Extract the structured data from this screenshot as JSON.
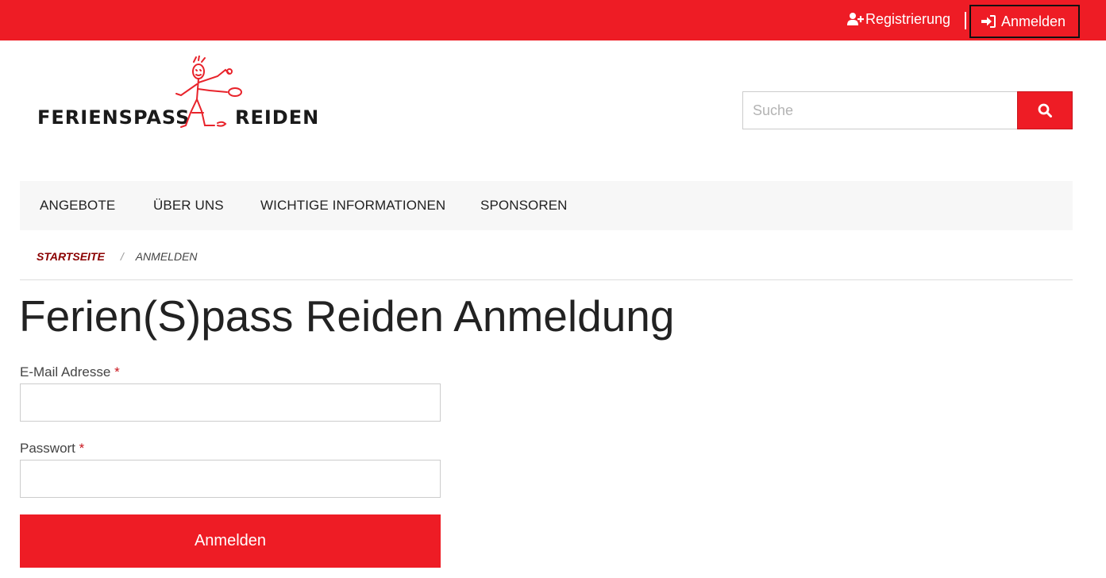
{
  "topbar": {
    "register_label": "Registrierung",
    "register_icon": "user-plus-icon",
    "login_label": "Anmelden",
    "login_icon": "sign-in-icon"
  },
  "logo": {
    "text_left": "FERIENSPASS",
    "text_right": "REIDEN"
  },
  "search": {
    "placeholder": "Suche",
    "button_icon": "search-icon"
  },
  "nav": {
    "items": [
      {
        "label": "ANGEBOTE"
      },
      {
        "label": "ÜBER UNS"
      },
      {
        "label": "WICHTIGE INFORMATIONEN"
      },
      {
        "label": "SPONSOREN"
      }
    ]
  },
  "breadcrumb": {
    "home": "STARTSEITE",
    "separator": "/",
    "current": "ANMELDEN"
  },
  "page": {
    "title": "Ferien(S)pass Reiden Anmeldung"
  },
  "form": {
    "email_label": "E-Mail Adresse",
    "password_label": "Passwort",
    "required_marker": "*",
    "submit_label": "Anmelden"
  },
  "colors": {
    "brand_red": "#ee1c25",
    "breadcrumb_home": "#8b0000",
    "nav_bg": "#f7f7f7"
  }
}
